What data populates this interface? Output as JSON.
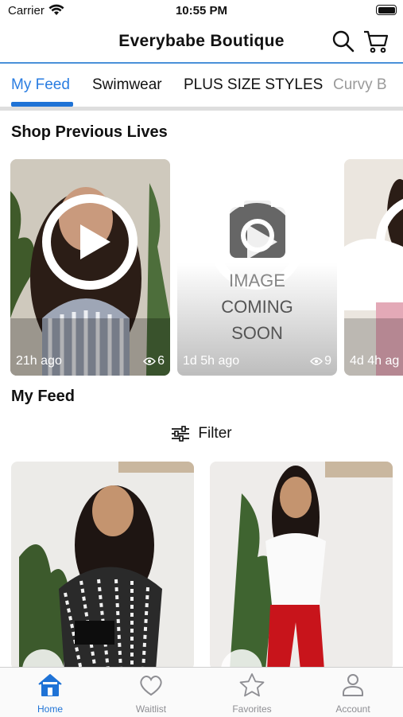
{
  "status_bar": {
    "carrier": "Carrier",
    "time": "10:55 PM"
  },
  "header": {
    "title": "Everybabe Boutique"
  },
  "tabs": [
    {
      "label": "My Feed"
    },
    {
      "label": "Swimwear"
    },
    {
      "label": "PLUS SIZE STYLES"
    },
    {
      "label": "Curvy B"
    }
  ],
  "previous_lives": {
    "title": "Shop Previous Lives",
    "cards": [
      {
        "time": "21h ago",
        "views": "6"
      },
      {
        "time": "1d 5h ago",
        "views": "9",
        "placeholder": [
          "IMAGE",
          "COMING",
          "SOON"
        ]
      },
      {
        "time": "4d 4h ag"
      }
    ]
  },
  "feed": {
    "title": "My Feed",
    "filter_label": "Filter"
  },
  "tabbar": [
    {
      "label": "Home",
      "icon": "home-icon"
    },
    {
      "label": "Waitlist",
      "icon": "heart-icon"
    },
    {
      "label": "Favorites",
      "icon": "star-icon"
    },
    {
      "label": "Account",
      "icon": "person-icon"
    }
  ],
  "colors": {
    "accent": "#1f73d6",
    "header_line": "#4a90d9",
    "inactive": "#8e8e93"
  }
}
